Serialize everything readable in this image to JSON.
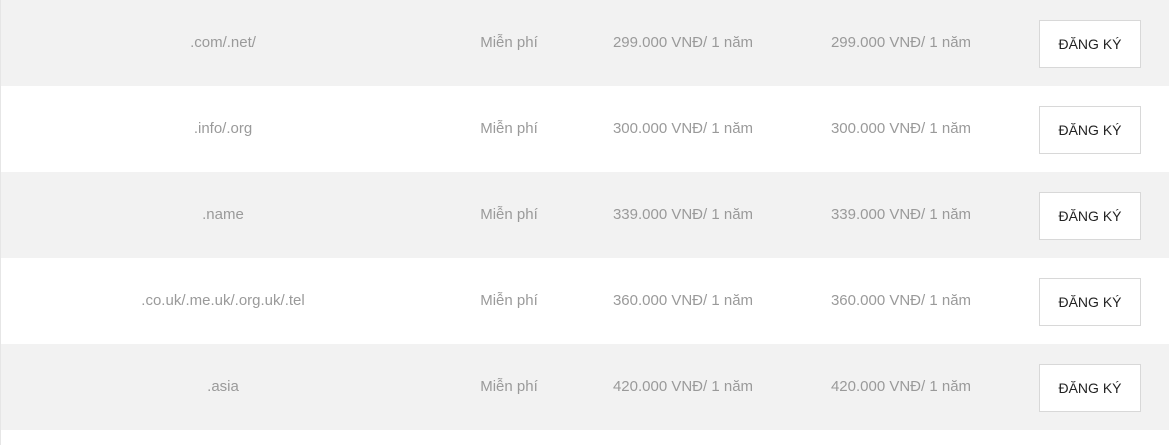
{
  "pricing_table": {
    "button_label": "ĐĂNG KÝ",
    "rows": [
      {
        "domain": ".com/.net/",
        "setup_fee": "Miễn phí",
        "register_price": "299.000 VNĐ/ 1 năm",
        "renew_price": "299.000 VNĐ/ 1 năm"
      },
      {
        "domain": ".info/.org",
        "setup_fee": "Miễn phí",
        "register_price": "300.000 VNĐ/ 1 năm",
        "renew_price": "300.000 VNĐ/ 1 năm"
      },
      {
        "domain": ".name",
        "setup_fee": "Miễn phí",
        "register_price": "339.000 VNĐ/ 1 năm",
        "renew_price": "339.000 VNĐ/ 1 năm"
      },
      {
        "domain": ".co.uk/.me.uk/.org.uk/.tel",
        "setup_fee": "Miễn phí",
        "register_price": "360.000 VNĐ/ 1 năm",
        "renew_price": "360.000 VNĐ/ 1 năm"
      },
      {
        "domain": ".asia",
        "setup_fee": "Miễn phí",
        "register_price": "420.000 VNĐ/ 1 năm",
        "renew_price": "420.000 VNĐ/ 1 năm"
      }
    ]
  },
  "colors": {
    "row_shaded": "#f2f2f2",
    "row_plain": "#ffffff",
    "text_muted": "#9a9a9a",
    "button_text": "#222222",
    "button_border": "#d8d8d8"
  }
}
